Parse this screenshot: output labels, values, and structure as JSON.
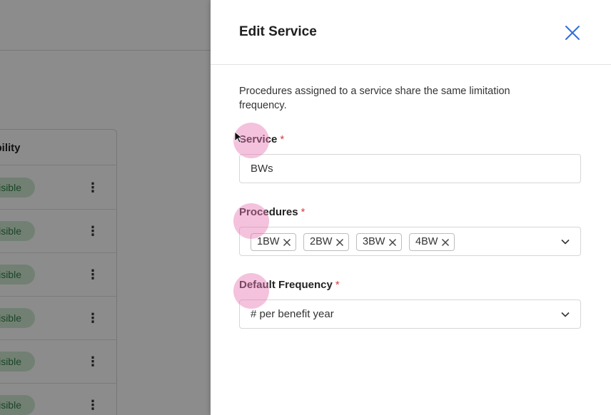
{
  "background": {
    "table_header": "sibility",
    "rows": [
      {
        "badge": "Visible"
      },
      {
        "badge": "Visible"
      },
      {
        "badge": "Visible"
      },
      {
        "badge": "Visible"
      },
      {
        "badge": "Visible"
      },
      {
        "badge": "Visible"
      }
    ],
    "kebab_glyph": "⋮"
  },
  "drawer": {
    "title": "Edit Service",
    "description": "Procedures assigned to a service share the same limitation frequency.",
    "service": {
      "label": "Service",
      "required_mark": "*",
      "value": "BWs"
    },
    "procedures": {
      "label": "Procedures",
      "required_mark": "*",
      "chips": [
        "1BW",
        "2BW",
        "3BW",
        "4BW"
      ]
    },
    "frequency": {
      "label": "Default Frequency",
      "required_mark": "*",
      "value": "# per benefit year"
    }
  },
  "colors": {
    "accent": "#2f6fd6",
    "required": "#d93b3b",
    "badge_bg": "#cfe9d4",
    "badge_text": "#2e7d44"
  }
}
